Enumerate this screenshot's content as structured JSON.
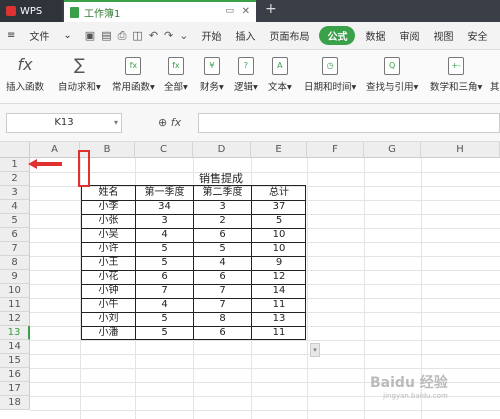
{
  "titlebar": {
    "app": "WPS",
    "doc_title": "工作簿1"
  },
  "menu": {
    "file_label": "文件",
    "tabs": [
      "开始",
      "插入",
      "页面布局",
      "公式",
      "数据",
      "审阅",
      "视图",
      "安全"
    ],
    "active_tab": "公式"
  },
  "ribbon": {
    "items": [
      {
        "label": "插入函数",
        "icon": "fx"
      },
      {
        "label": "自动求和",
        "icon": "∑"
      },
      {
        "label": "常用函数",
        "icon": "fx"
      },
      {
        "label": "全部",
        "icon": "fx"
      },
      {
        "label": "财务",
        "icon": "¥"
      },
      {
        "label": "逻辑",
        "icon": "?"
      },
      {
        "label": "文本",
        "icon": "A"
      },
      {
        "label": "日期和时间",
        "icon": "◷"
      },
      {
        "label": "查找与引用",
        "icon": "Q"
      },
      {
        "label": "数学和三角",
        "icon": "+-"
      },
      {
        "label": "其",
        "icon": ""
      }
    ]
  },
  "formula_bar": {
    "cell_ref": "K13",
    "fx_label": "fx",
    "value": ""
  },
  "grid": {
    "columns": [
      "A",
      "B",
      "C",
      "D",
      "E",
      "F",
      "G",
      "H"
    ],
    "rows": [
      "1",
      "2",
      "3",
      "4",
      "5",
      "6",
      "7",
      "8",
      "9",
      "10",
      "11",
      "12",
      "13",
      "14",
      "15",
      "16",
      "17",
      "18"
    ],
    "selected_row": "13"
  },
  "table": {
    "title": "销售提成",
    "headers": [
      "姓名",
      "第一季度",
      "第二季度",
      "总计"
    ],
    "rows": [
      [
        "小李",
        "34",
        "3",
        "37"
      ],
      [
        "小张",
        "3",
        "2",
        "5"
      ],
      [
        "小吴",
        "4",
        "6",
        "10"
      ],
      [
        "小许",
        "5",
        "5",
        "10"
      ],
      [
        "小王",
        "5",
        "4",
        "9"
      ],
      [
        "小花",
        "6",
        "6",
        "12"
      ],
      [
        "小钟",
        "7",
        "7",
        "14"
      ],
      [
        "小牛",
        "4",
        "7",
        "11"
      ],
      [
        "小刘",
        "5",
        "8",
        "13"
      ],
      [
        "小潘",
        "5",
        "6",
        "11"
      ]
    ]
  },
  "watermark": {
    "text": "Baidu 经验",
    "sub": "jingyan.baidu.com"
  },
  "colors": {
    "accent": "#3aa14a",
    "annotation": "#e03030"
  }
}
